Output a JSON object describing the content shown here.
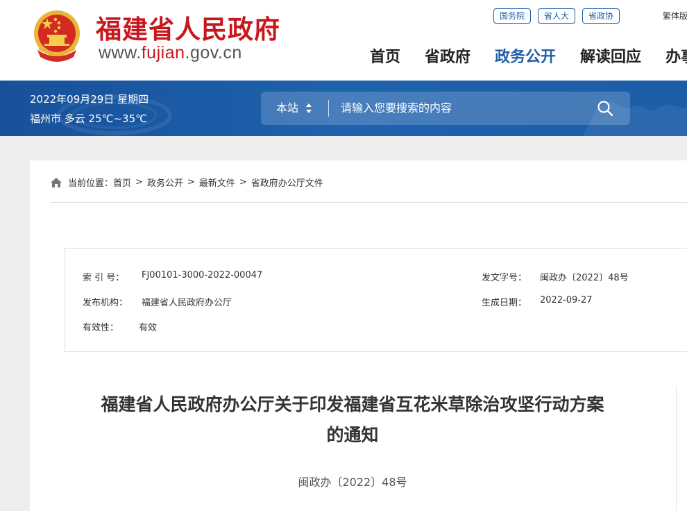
{
  "header": {
    "site_name": "福建省人民政府",
    "url_prefix": "www.",
    "url_highlight": "fujian",
    "url_suffix": ".gov.cn",
    "top_links": [
      "国务院",
      "省人大",
      "省政协"
    ],
    "lang_switch": "繁体版",
    "nav": [
      {
        "label": "首页",
        "active": false
      },
      {
        "label": "省政府",
        "active": false
      },
      {
        "label": "政务公开",
        "active": true
      },
      {
        "label": "解读回应",
        "active": false
      },
      {
        "label": "办事服务",
        "active": false
      }
    ]
  },
  "banner": {
    "date": "2022年09月29日 星期四",
    "weather": "福州市 多云 25℃~35℃",
    "search": {
      "scope": "本站",
      "placeholder": "请输入您要搜索的内容"
    }
  },
  "breadcrumb": {
    "prefix": "当前位置：",
    "items": [
      "首页",
      "政务公开",
      "最新文件",
      "省政府办公厅文件"
    ],
    "separator": ">"
  },
  "doc_info": {
    "index_label": "索 引 号：",
    "index_value": "FJ00101-3000-2022-00047",
    "doc_no_label": "发文字号：",
    "doc_no_value": "闽政办〔2022〕48号",
    "issuer_label": "发布机构：",
    "issuer_value": "福建省人民政府办公厅",
    "date_label": "生成日期：",
    "date_value": "2022-09-27",
    "validity_label": "有效性：",
    "validity_value": "有效"
  },
  "document": {
    "title_line1": "福建省人民政府办公厅关于印发福建省互花米草除治攻坚行动方案",
    "title_line2": "的通知",
    "number": "闽政办〔2022〕48号"
  },
  "colors": {
    "brand_red": "#c8161d",
    "brand_blue": "#1f5fa8",
    "banner_blue": "#1d5da8",
    "page_bg": "#ededed"
  },
  "icons": [
    "national-emblem-icon",
    "sort-arrows-icon",
    "search-icon",
    "home-icon"
  ]
}
